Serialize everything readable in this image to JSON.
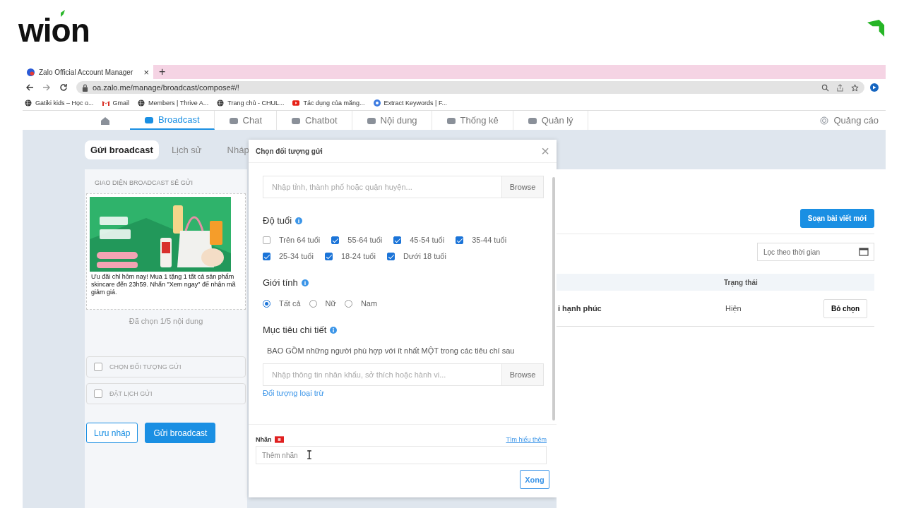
{
  "brand": {
    "name": "wion"
  },
  "browser": {
    "tab": {
      "title": "Zalo Official Account Manager",
      "close": "×"
    },
    "new_tab": "+",
    "url": "oa.zalo.me/manage/broadcast/compose#/!",
    "bookmarks": [
      {
        "label": "Gatiki kids – Học o...",
        "kind": "globe"
      },
      {
        "label": "Gmail",
        "kind": "mail"
      },
      {
        "label": "Members | Thrive A...",
        "kind": "globe"
      },
      {
        "label": "Trang chủ - CHUL...",
        "kind": "globe"
      },
      {
        "label": "Tác dụng của măng...",
        "kind": "video"
      },
      {
        "label": "Extract Keywords | F...",
        "kind": "app"
      }
    ]
  },
  "app_nav": {
    "items": [
      {
        "label": "Broadcast",
        "selected": true
      },
      {
        "label": "Chat",
        "selected": false
      },
      {
        "label": "Chatbot",
        "selected": false
      },
      {
        "label": "Nội dung",
        "selected": false
      },
      {
        "label": "Thống kê",
        "selected": false
      },
      {
        "label": "Quản lý",
        "selected": false
      }
    ],
    "ads": "Quảng cáo"
  },
  "compose_tabs": [
    {
      "label": "Gửi broadcast",
      "selected": true
    },
    {
      "label": "Lịch sử",
      "selected": false
    },
    {
      "label": "Nháp",
      "selected": false
    }
  ],
  "preview_panel": {
    "heading": "GIAO DIỆN BROADCAST SẼ GỬI",
    "caption": "Ưu đãi chỉ hôm nay!  Mua 1 tặng 1 tất cả sản phẩm skincare đến 23h59.   Nhấn \"Xem ngay\" để nhận mã giảm giá.",
    "selected_count": "Đã chọn 1/5 nội dung",
    "options": [
      {
        "label": "CHỌN ĐỐI TƯỢNG GỬI",
        "checked": false
      },
      {
        "label": "ĐẶT LỊCH GỬI",
        "checked": false
      }
    ],
    "buttons": [
      {
        "label": "Lưu nháp",
        "kind": "secondary"
      },
      {
        "label": "Gửi broadcast",
        "kind": "primary"
      }
    ]
  },
  "dialog": {
    "title": "Chọn đối tượng gửi",
    "close": "×",
    "location": {
      "placeholder": "Nhập tỉnh, thành phố hoặc quận huyện...",
      "browse": "Browse"
    },
    "age": {
      "heading": "Độ tuổi",
      "options": [
        {
          "label": "Trên 64 tuổi",
          "checked": false
        },
        {
          "label": "55-64 tuổi",
          "checked": true
        },
        {
          "label": "45-54 tuổi",
          "checked": true
        },
        {
          "label": "35-44 tuổi",
          "checked": true
        },
        {
          "label": "25-34 tuổi",
          "checked": true
        },
        {
          "label": "18-24 tuổi",
          "checked": true
        },
        {
          "label": "Dưới 18 tuổi",
          "checked": true
        }
      ]
    },
    "gender": {
      "heading": "Giới tính",
      "options": [
        {
          "label": "Tất cả",
          "selected": true
        },
        {
          "label": "Nữ",
          "selected": false
        },
        {
          "label": "Nam",
          "selected": false
        }
      ]
    },
    "targeting": {
      "heading": "Mục tiêu chi tiết",
      "description": "BAO GỒM những người phù hợp với ít nhất MỘT trong các tiêu chí sau",
      "placeholder": "Nhập thông tin nhân khẩu, sở thích hoặc hành vi...",
      "browse": "Browse",
      "exclude_link": "Đối tượng loại trừ"
    },
    "tag": {
      "heading": "Nhãn",
      "learn_more": "Tìm hiểu thêm",
      "placeholder": "Thêm nhãn"
    },
    "done": "Xong"
  },
  "post_list": {
    "new_button": "Soạn bài viết mới",
    "filter_placeholder": "Lọc theo thời gian",
    "columns": [
      "Trạng thái"
    ],
    "rows": [
      {
        "title": "i hạnh phúc",
        "status": "Hiện",
        "action": "Bỏ chọn"
      }
    ]
  }
}
